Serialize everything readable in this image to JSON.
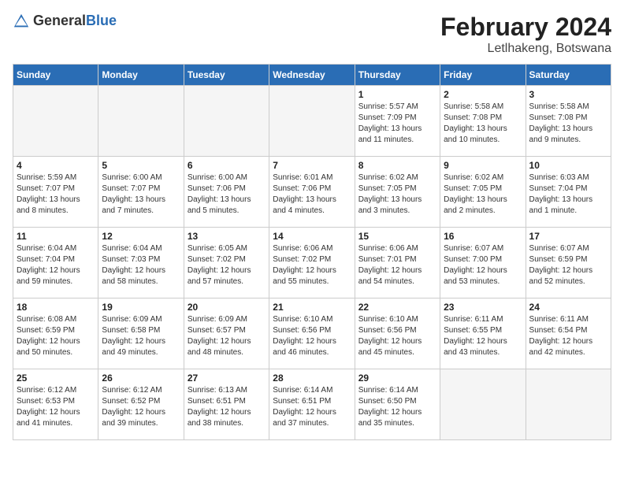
{
  "header": {
    "logo_general": "General",
    "logo_blue": "Blue",
    "month_year": "February 2024",
    "location": "Letlhakeng, Botswana"
  },
  "days_of_week": [
    "Sunday",
    "Monday",
    "Tuesday",
    "Wednesday",
    "Thursday",
    "Friday",
    "Saturday"
  ],
  "weeks": [
    [
      {
        "day": "",
        "empty": true
      },
      {
        "day": "",
        "empty": true
      },
      {
        "day": "",
        "empty": true
      },
      {
        "day": "",
        "empty": true
      },
      {
        "day": "1",
        "sunrise": "Sunrise: 5:57 AM",
        "sunset": "Sunset: 7:09 PM",
        "daylight": "Daylight: 13 hours and 11 minutes."
      },
      {
        "day": "2",
        "sunrise": "Sunrise: 5:58 AM",
        "sunset": "Sunset: 7:08 PM",
        "daylight": "Daylight: 13 hours and 10 minutes."
      },
      {
        "day": "3",
        "sunrise": "Sunrise: 5:58 AM",
        "sunset": "Sunset: 7:08 PM",
        "daylight": "Daylight: 13 hours and 9 minutes."
      }
    ],
    [
      {
        "day": "4",
        "sunrise": "Sunrise: 5:59 AM",
        "sunset": "Sunset: 7:07 PM",
        "daylight": "Daylight: 13 hours and 8 minutes."
      },
      {
        "day": "5",
        "sunrise": "Sunrise: 6:00 AM",
        "sunset": "Sunset: 7:07 PM",
        "daylight": "Daylight: 13 hours and 7 minutes."
      },
      {
        "day": "6",
        "sunrise": "Sunrise: 6:00 AM",
        "sunset": "Sunset: 7:06 PM",
        "daylight": "Daylight: 13 hours and 5 minutes."
      },
      {
        "day": "7",
        "sunrise": "Sunrise: 6:01 AM",
        "sunset": "Sunset: 7:06 PM",
        "daylight": "Daylight: 13 hours and 4 minutes."
      },
      {
        "day": "8",
        "sunrise": "Sunrise: 6:02 AM",
        "sunset": "Sunset: 7:05 PM",
        "daylight": "Daylight: 13 hours and 3 minutes."
      },
      {
        "day": "9",
        "sunrise": "Sunrise: 6:02 AM",
        "sunset": "Sunset: 7:05 PM",
        "daylight": "Daylight: 13 hours and 2 minutes."
      },
      {
        "day": "10",
        "sunrise": "Sunrise: 6:03 AM",
        "sunset": "Sunset: 7:04 PM",
        "daylight": "Daylight: 13 hours and 1 minute."
      }
    ],
    [
      {
        "day": "11",
        "sunrise": "Sunrise: 6:04 AM",
        "sunset": "Sunset: 7:04 PM",
        "daylight": "Daylight: 12 hours and 59 minutes."
      },
      {
        "day": "12",
        "sunrise": "Sunrise: 6:04 AM",
        "sunset": "Sunset: 7:03 PM",
        "daylight": "Daylight: 12 hours and 58 minutes."
      },
      {
        "day": "13",
        "sunrise": "Sunrise: 6:05 AM",
        "sunset": "Sunset: 7:02 PM",
        "daylight": "Daylight: 12 hours and 57 minutes."
      },
      {
        "day": "14",
        "sunrise": "Sunrise: 6:06 AM",
        "sunset": "Sunset: 7:02 PM",
        "daylight": "Daylight: 12 hours and 55 minutes."
      },
      {
        "day": "15",
        "sunrise": "Sunrise: 6:06 AM",
        "sunset": "Sunset: 7:01 PM",
        "daylight": "Daylight: 12 hours and 54 minutes."
      },
      {
        "day": "16",
        "sunrise": "Sunrise: 6:07 AM",
        "sunset": "Sunset: 7:00 PM",
        "daylight": "Daylight: 12 hours and 53 minutes."
      },
      {
        "day": "17",
        "sunrise": "Sunrise: 6:07 AM",
        "sunset": "Sunset: 6:59 PM",
        "daylight": "Daylight: 12 hours and 52 minutes."
      }
    ],
    [
      {
        "day": "18",
        "sunrise": "Sunrise: 6:08 AM",
        "sunset": "Sunset: 6:59 PM",
        "daylight": "Daylight: 12 hours and 50 minutes."
      },
      {
        "day": "19",
        "sunrise": "Sunrise: 6:09 AM",
        "sunset": "Sunset: 6:58 PM",
        "daylight": "Daylight: 12 hours and 49 minutes."
      },
      {
        "day": "20",
        "sunrise": "Sunrise: 6:09 AM",
        "sunset": "Sunset: 6:57 PM",
        "daylight": "Daylight: 12 hours and 48 minutes."
      },
      {
        "day": "21",
        "sunrise": "Sunrise: 6:10 AM",
        "sunset": "Sunset: 6:56 PM",
        "daylight": "Daylight: 12 hours and 46 minutes."
      },
      {
        "day": "22",
        "sunrise": "Sunrise: 6:10 AM",
        "sunset": "Sunset: 6:56 PM",
        "daylight": "Daylight: 12 hours and 45 minutes."
      },
      {
        "day": "23",
        "sunrise": "Sunrise: 6:11 AM",
        "sunset": "Sunset: 6:55 PM",
        "daylight": "Daylight: 12 hours and 43 minutes."
      },
      {
        "day": "24",
        "sunrise": "Sunrise: 6:11 AM",
        "sunset": "Sunset: 6:54 PM",
        "daylight": "Daylight: 12 hours and 42 minutes."
      }
    ],
    [
      {
        "day": "25",
        "sunrise": "Sunrise: 6:12 AM",
        "sunset": "Sunset: 6:53 PM",
        "daylight": "Daylight: 12 hours and 41 minutes."
      },
      {
        "day": "26",
        "sunrise": "Sunrise: 6:12 AM",
        "sunset": "Sunset: 6:52 PM",
        "daylight": "Daylight: 12 hours and 39 minutes."
      },
      {
        "day": "27",
        "sunrise": "Sunrise: 6:13 AM",
        "sunset": "Sunset: 6:51 PM",
        "daylight": "Daylight: 12 hours and 38 minutes."
      },
      {
        "day": "28",
        "sunrise": "Sunrise: 6:14 AM",
        "sunset": "Sunset: 6:51 PM",
        "daylight": "Daylight: 12 hours and 37 minutes."
      },
      {
        "day": "29",
        "sunrise": "Sunrise: 6:14 AM",
        "sunset": "Sunset: 6:50 PM",
        "daylight": "Daylight: 12 hours and 35 minutes."
      },
      {
        "day": "",
        "empty": true
      },
      {
        "day": "",
        "empty": true
      }
    ]
  ]
}
